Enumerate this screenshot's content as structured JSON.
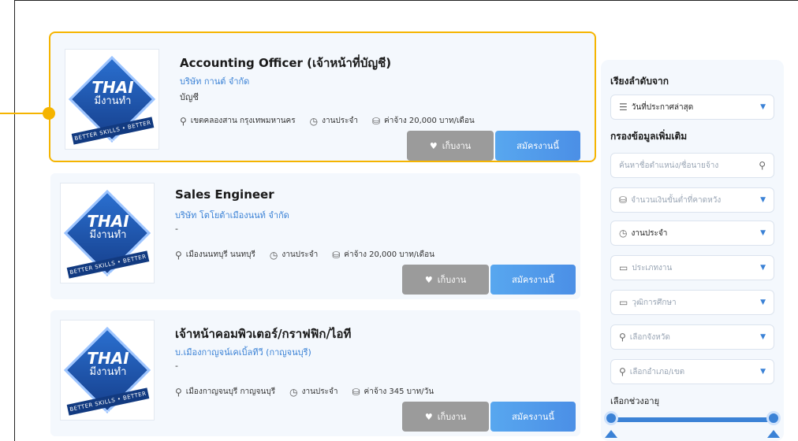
{
  "jobs": [
    {
      "title": "Accounting Officer (เจ้าหน้าที่บัญชี)",
      "company": "บริษัท กานต์ จำกัด",
      "category": "บัญชี",
      "location": "เขตคลองสาน กรุงเทพมหานคร",
      "job_type": "งานประจำ",
      "salary": "ค่าจ้าง 20,000 บาท/เดือน",
      "highlighted": true
    },
    {
      "title": "Sales Engineer",
      "company": "บริษัท โตโยต้าเมืองนนท์ จำกัด",
      "category": "-",
      "location": "เมืองนนทบุรี นนทบุรี",
      "job_type": "งานประจำ",
      "salary": "ค่าจ้าง 20,000 บาท/เดือน",
      "highlighted": false
    },
    {
      "title": "เจ้าหน้าคอมพิวเตอร์/กราฟฟิก/ไอที",
      "company": "บ.เมืองกาญจน์เคเบิ้ลทีวี (กาญจนบุรี)",
      "category": "-",
      "location": "เมืองกาญจนบุรี กาญจนบุรี",
      "job_type": "งานประจำ",
      "salary": "ค่าจ้าง 345 บาท/วัน",
      "highlighted": false
    }
  ],
  "logo": {
    "line1": "THAI",
    "line2": "มีงานทำ",
    "ribbon": "BETTER SKILLS • BETTER JOBS"
  },
  "buttons": {
    "save": "เก็บงาน",
    "apply": "สมัครงานนี้"
  },
  "sidebar": {
    "sort_label": "เรียงลำดับจาก",
    "sort_value": "วันที่ประกาศล่าสุด",
    "filter_label": "กรองข้อมูลเพิ่มเติม",
    "search_placeholder": "ค้นหาชื่อตำแหน่ง/ชื่อนายจ้าง",
    "salary_placeholder": "จำนวนเงินขั้นต่ำที่คาดหวัง",
    "job_type_value": "งานประจำ",
    "job_category_placeholder": "ประเภทงาน",
    "education_placeholder": "วุฒิการศึกษา",
    "province_placeholder": "เลือกจังหวัด",
    "district_placeholder": "เลือกอำเภอ/เขต",
    "age_label": "เลือกช่วงอายุ"
  },
  "colors": {
    "accent": "#3b82d6",
    "highlight": "#f5b400",
    "save_button": "#9b9b9b"
  },
  "icons": [
    "location-pin-icon",
    "clock-icon",
    "money-icon",
    "heart-icon",
    "sort-icon",
    "search-icon",
    "briefcase-icon",
    "education-icon",
    "chevron-down-icon"
  ]
}
